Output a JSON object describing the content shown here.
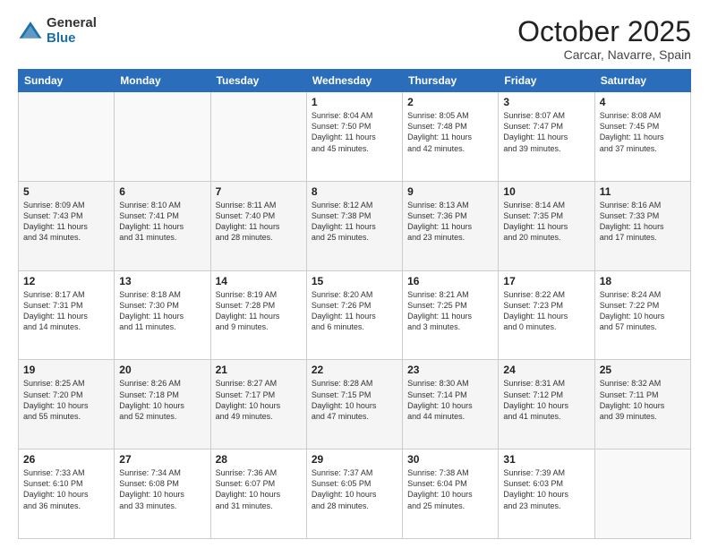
{
  "logo": {
    "general": "General",
    "blue": "Blue"
  },
  "header": {
    "month": "October 2025",
    "location": "Carcar, Navarre, Spain"
  },
  "weekdays": [
    "Sunday",
    "Monday",
    "Tuesday",
    "Wednesday",
    "Thursday",
    "Friday",
    "Saturday"
  ],
  "weeks": [
    [
      {
        "day": "",
        "info": ""
      },
      {
        "day": "",
        "info": ""
      },
      {
        "day": "",
        "info": ""
      },
      {
        "day": "1",
        "info": "Sunrise: 8:04 AM\nSunset: 7:50 PM\nDaylight: 11 hours\nand 45 minutes."
      },
      {
        "day": "2",
        "info": "Sunrise: 8:05 AM\nSunset: 7:48 PM\nDaylight: 11 hours\nand 42 minutes."
      },
      {
        "day": "3",
        "info": "Sunrise: 8:07 AM\nSunset: 7:47 PM\nDaylight: 11 hours\nand 39 minutes."
      },
      {
        "day": "4",
        "info": "Sunrise: 8:08 AM\nSunset: 7:45 PM\nDaylight: 11 hours\nand 37 minutes."
      }
    ],
    [
      {
        "day": "5",
        "info": "Sunrise: 8:09 AM\nSunset: 7:43 PM\nDaylight: 11 hours\nand 34 minutes."
      },
      {
        "day": "6",
        "info": "Sunrise: 8:10 AM\nSunset: 7:41 PM\nDaylight: 11 hours\nand 31 minutes."
      },
      {
        "day": "7",
        "info": "Sunrise: 8:11 AM\nSunset: 7:40 PM\nDaylight: 11 hours\nand 28 minutes."
      },
      {
        "day": "8",
        "info": "Sunrise: 8:12 AM\nSunset: 7:38 PM\nDaylight: 11 hours\nand 25 minutes."
      },
      {
        "day": "9",
        "info": "Sunrise: 8:13 AM\nSunset: 7:36 PM\nDaylight: 11 hours\nand 23 minutes."
      },
      {
        "day": "10",
        "info": "Sunrise: 8:14 AM\nSunset: 7:35 PM\nDaylight: 11 hours\nand 20 minutes."
      },
      {
        "day": "11",
        "info": "Sunrise: 8:16 AM\nSunset: 7:33 PM\nDaylight: 11 hours\nand 17 minutes."
      }
    ],
    [
      {
        "day": "12",
        "info": "Sunrise: 8:17 AM\nSunset: 7:31 PM\nDaylight: 11 hours\nand 14 minutes."
      },
      {
        "day": "13",
        "info": "Sunrise: 8:18 AM\nSunset: 7:30 PM\nDaylight: 11 hours\nand 11 minutes."
      },
      {
        "day": "14",
        "info": "Sunrise: 8:19 AM\nSunset: 7:28 PM\nDaylight: 11 hours\nand 9 minutes."
      },
      {
        "day": "15",
        "info": "Sunrise: 8:20 AM\nSunset: 7:26 PM\nDaylight: 11 hours\nand 6 minutes."
      },
      {
        "day": "16",
        "info": "Sunrise: 8:21 AM\nSunset: 7:25 PM\nDaylight: 11 hours\nand 3 minutes."
      },
      {
        "day": "17",
        "info": "Sunrise: 8:22 AM\nSunset: 7:23 PM\nDaylight: 11 hours\nand 0 minutes."
      },
      {
        "day": "18",
        "info": "Sunrise: 8:24 AM\nSunset: 7:22 PM\nDaylight: 10 hours\nand 57 minutes."
      }
    ],
    [
      {
        "day": "19",
        "info": "Sunrise: 8:25 AM\nSunset: 7:20 PM\nDaylight: 10 hours\nand 55 minutes."
      },
      {
        "day": "20",
        "info": "Sunrise: 8:26 AM\nSunset: 7:18 PM\nDaylight: 10 hours\nand 52 minutes."
      },
      {
        "day": "21",
        "info": "Sunrise: 8:27 AM\nSunset: 7:17 PM\nDaylight: 10 hours\nand 49 minutes."
      },
      {
        "day": "22",
        "info": "Sunrise: 8:28 AM\nSunset: 7:15 PM\nDaylight: 10 hours\nand 47 minutes."
      },
      {
        "day": "23",
        "info": "Sunrise: 8:30 AM\nSunset: 7:14 PM\nDaylight: 10 hours\nand 44 minutes."
      },
      {
        "day": "24",
        "info": "Sunrise: 8:31 AM\nSunset: 7:12 PM\nDaylight: 10 hours\nand 41 minutes."
      },
      {
        "day": "25",
        "info": "Sunrise: 8:32 AM\nSunset: 7:11 PM\nDaylight: 10 hours\nand 39 minutes."
      }
    ],
    [
      {
        "day": "26",
        "info": "Sunrise: 7:33 AM\nSunset: 6:10 PM\nDaylight: 10 hours\nand 36 minutes."
      },
      {
        "day": "27",
        "info": "Sunrise: 7:34 AM\nSunset: 6:08 PM\nDaylight: 10 hours\nand 33 minutes."
      },
      {
        "day": "28",
        "info": "Sunrise: 7:36 AM\nSunset: 6:07 PM\nDaylight: 10 hours\nand 31 minutes."
      },
      {
        "day": "29",
        "info": "Sunrise: 7:37 AM\nSunset: 6:05 PM\nDaylight: 10 hours\nand 28 minutes."
      },
      {
        "day": "30",
        "info": "Sunrise: 7:38 AM\nSunset: 6:04 PM\nDaylight: 10 hours\nand 25 minutes."
      },
      {
        "day": "31",
        "info": "Sunrise: 7:39 AM\nSunset: 6:03 PM\nDaylight: 10 hours\nand 23 minutes."
      },
      {
        "day": "",
        "info": ""
      }
    ]
  ]
}
